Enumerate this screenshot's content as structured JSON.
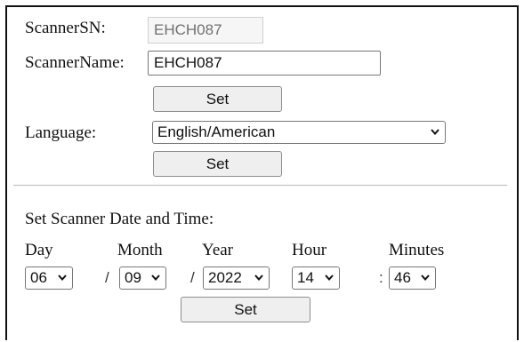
{
  "scanner": {
    "sn_label": "ScannerSN:",
    "sn_value": "EHCH087",
    "name_label": "ScannerName:",
    "name_value": "EHCH087",
    "set_label": "Set"
  },
  "language": {
    "label": "Language:",
    "selected": "English/American",
    "set_label": "Set"
  },
  "datetime": {
    "heading": "Set Scanner Date and Time:",
    "day_label": "Day",
    "month_label": "Month",
    "year_label": "Year",
    "hour_label": "Hour",
    "minutes_label": "Minutes",
    "day_value": "06",
    "month_value": "09",
    "year_value": "2022",
    "hour_value": "14",
    "minutes_value": "46",
    "sep_slash": "/",
    "sep_colon": ":",
    "set_label": "Set"
  },
  "icons": {
    "dropdown": "chevron-down-icon"
  }
}
